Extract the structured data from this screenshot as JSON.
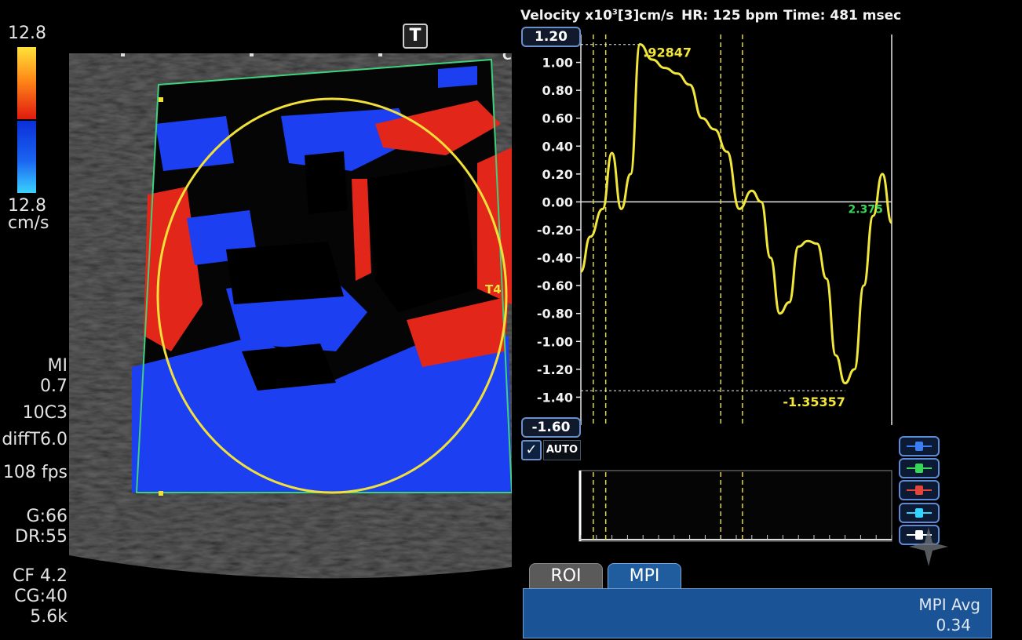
{
  "scale": {
    "top_value": "12.8",
    "bottom_value": "12.8",
    "unit": "cm/s"
  },
  "side_params": {
    "mi_label": "MI",
    "mi_value": "0.7",
    "probe": "10C3",
    "mode": "diffT6.0",
    "fps": "108 fps",
    "gain": "G:66",
    "dynamic_range": "DR:55",
    "cf": "CF 4.2",
    "cg": "CG:40",
    "prf": "5.6k"
  },
  "image_markers": {
    "t_button": "T",
    "c_marker": "C",
    "t4_label": "T4"
  },
  "colors": {
    "trace": "#f1e63a",
    "frame": "#3ed17a",
    "roi_circle": "#f1e03a",
    "accent_blue": "#1f5d9e"
  },
  "graph": {
    "y_label_prefix": "Velocity x10",
    "y_label_sup": "3",
    "y_label_suffix": "[3]cm/s",
    "hr": "HR: 125 bpm",
    "time": "Time: 481 msec",
    "ymax_box": "1.20",
    "ymin_box": "-1.60",
    "auto_label": "AUTO",
    "auto_checked": "✓"
  },
  "chart_data": {
    "type": "line",
    "ylim": [
      -1.6,
      1.2
    ],
    "yticks": [
      1.2,
      1.0,
      0.8,
      0.6,
      0.4,
      0.2,
      0.0,
      -0.2,
      -0.4,
      -0.6,
      -0.8,
      -1.0,
      -1.2,
      -1.4,
      -1.6
    ],
    "ytick_labels": [
      "1.20",
      "1.00",
      "0.80",
      "0.60",
      "0.40",
      "0.20",
      "0.00",
      "-0.20",
      "-0.40",
      "-0.60",
      "-0.80",
      "-1.00",
      "-1.20",
      "-1.40",
      "-1.60"
    ],
    "series": [
      {
        "x": [
          0,
          3,
          7,
          10,
          13,
          16,
          19,
          23,
          27,
          31,
          35,
          39,
          43,
          47,
          51,
          55,
          58,
          61,
          64,
          67,
          70,
          73,
          76,
          79,
          82,
          85,
          88,
          91,
          94,
          97,
          100
        ],
        "y": [
          -0.5,
          -0.25,
          -0.05,
          0.35,
          -0.05,
          0.2,
          1.13,
          1.02,
          0.96,
          0.92,
          0.84,
          0.6,
          0.52,
          0.36,
          -0.05,
          0.08,
          0.0,
          -0.4,
          -0.8,
          -0.72,
          -0.32,
          -0.28,
          -0.3,
          -0.55,
          -1.1,
          -1.3,
          -1.2,
          -0.6,
          -0.1,
          0.2,
          -0.15
        ]
      }
    ],
    "annotations": [
      {
        "label": ".92847",
        "value": 1.12847
      },
      {
        "label": "-1.35357",
        "value": -1.35357
      },
      {
        "label": "2.375",
        "value": 0.0
      }
    ],
    "markers_x": [
      4,
      8,
      45,
      52
    ]
  },
  "tools": [
    {
      "name": "blue-tool",
      "color": "#3b7df5"
    },
    {
      "name": "green-tool",
      "color": "#36d957"
    },
    {
      "name": "red-tool",
      "color": "#e5443a"
    },
    {
      "name": "cyan-tool",
      "color": "#33d4ff"
    },
    {
      "name": "white-tool",
      "color": "#ffffff"
    }
  ],
  "tabs": {
    "roi": "ROI",
    "mpi": "MPI"
  },
  "mpi": {
    "avg_label": "MPI Avg",
    "avg_value": "0.34"
  }
}
